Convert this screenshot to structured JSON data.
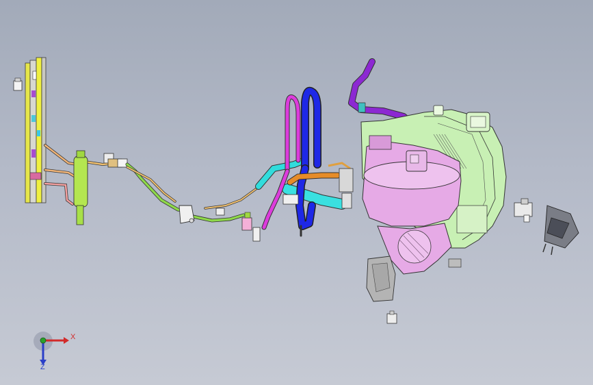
{
  "window": {
    "title": ""
  },
  "viewport": {
    "background_top": "#a2aab9",
    "background_bottom": "#c6cad4"
  },
  "model": {
    "components": [
      {
        "name": "mounting-bracket-panel",
        "color": "#e6e64a"
      },
      {
        "name": "wire-harness-left",
        "color": "#f0b478"
      },
      {
        "name": "green-connector-body",
        "color": "#b4e650"
      },
      {
        "name": "green-harness",
        "color": "#8ed84a"
      },
      {
        "name": "magenta-pipe",
        "color": "#dc3cdc"
      },
      {
        "name": "blue-pipe",
        "color": "#1e28e6"
      },
      {
        "name": "cyan-duct",
        "color": "#32dcdc"
      },
      {
        "name": "purple-hose",
        "color": "#8c28d2"
      },
      {
        "name": "blower-housing",
        "color": "#e6aae6"
      },
      {
        "name": "evaporator-case",
        "color": "#c8f0b4"
      },
      {
        "name": "orange-connector",
        "color": "#e68c28"
      }
    ]
  },
  "triad": {
    "x_label": "X",
    "z_label": "Z",
    "x_color": "#d22a2a",
    "y_color": "#2aa02a",
    "z_color": "#2a3fc8"
  }
}
